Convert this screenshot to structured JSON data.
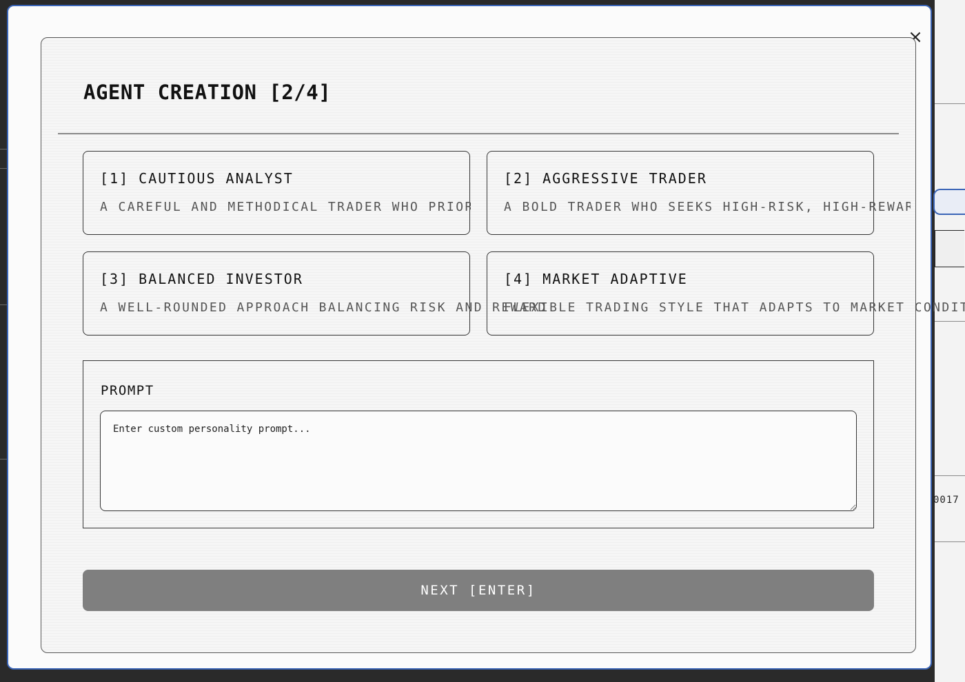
{
  "background": {
    "partial_text": "0017"
  },
  "modal": {
    "close_label": "×",
    "title": "AGENT CREATION [2/4]",
    "options": [
      {
        "label": "[1] CAUTIOUS ANALYST",
        "description": "A CAREFUL AND METHODICAL TRADER WHO PRIORITIZES RISK MANAGEMENT"
      },
      {
        "label": "[2] AGGRESSIVE TRADER",
        "description": "A BOLD TRADER WHO SEEKS HIGH-RISK, HIGH-REWARD OPPORTUNITIES"
      },
      {
        "label": "[3] BALANCED INVESTOR",
        "description": "A WELL-ROUNDED APPROACH BALANCING RISK AND REWARD"
      },
      {
        "label": "[4] MARKET ADAPTIVE",
        "description": "FLEXIBLE TRADING STYLE THAT ADAPTS TO MARKET CONDITIONS"
      }
    ],
    "prompt": {
      "label": "PROMPT",
      "placeholder": "Enter custom personality prompt...",
      "value": ""
    },
    "next_label": "NEXT [ENTER]"
  },
  "colors": {
    "accent_border": "#3a64b6",
    "button_bg": "#7f7f7f",
    "text": "#111111"
  }
}
